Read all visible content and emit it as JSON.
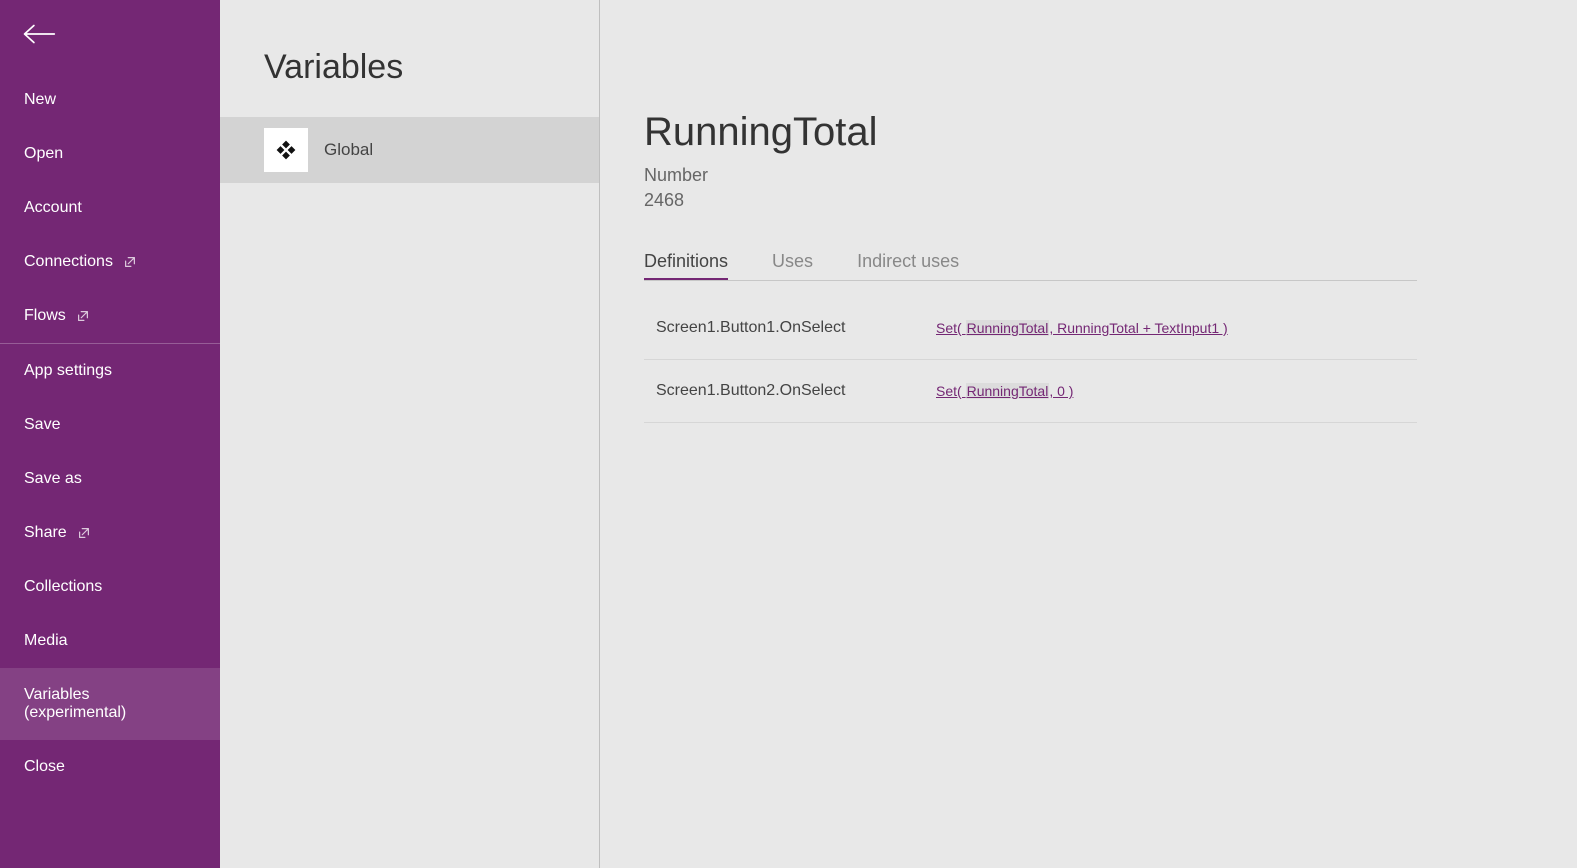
{
  "sidebar": {
    "items": [
      {
        "label": "New",
        "external": false
      },
      {
        "label": "Open",
        "external": false
      },
      {
        "label": "Account",
        "external": false
      },
      {
        "label": "Connections",
        "external": true
      },
      {
        "label": "Flows",
        "external": true
      },
      {
        "label": "App settings",
        "external": false
      },
      {
        "label": "Save",
        "external": false
      },
      {
        "label": "Save as",
        "external": false
      },
      {
        "label": "Share",
        "external": true
      },
      {
        "label": "Collections",
        "external": false
      },
      {
        "label": "Media",
        "external": false
      },
      {
        "label": "Variables (experimental)",
        "external": false,
        "active": true
      },
      {
        "label": "Close",
        "external": false
      }
    ],
    "divider_after_index": 4
  },
  "middle": {
    "title": "Variables",
    "scopes": [
      {
        "label": "Global"
      }
    ]
  },
  "main": {
    "variable_name": "RunningTotal",
    "variable_type": "Number",
    "variable_value": "2468",
    "tabs": [
      {
        "label": "Definitions",
        "active": true
      },
      {
        "label": "Uses",
        "active": false
      },
      {
        "label": "Indirect uses",
        "active": false
      }
    ],
    "definitions": [
      {
        "location": "Screen1.Button1.OnSelect",
        "formula_pre": "Set( ",
        "formula_hl": "RunningTotal",
        "formula_post": ", RunningTotal + TextInput1 )"
      },
      {
        "location": "Screen1.Button2.OnSelect",
        "formula_pre": "Set( ",
        "formula_hl": "RunningTotal",
        "formula_post": ", 0 )"
      }
    ]
  }
}
